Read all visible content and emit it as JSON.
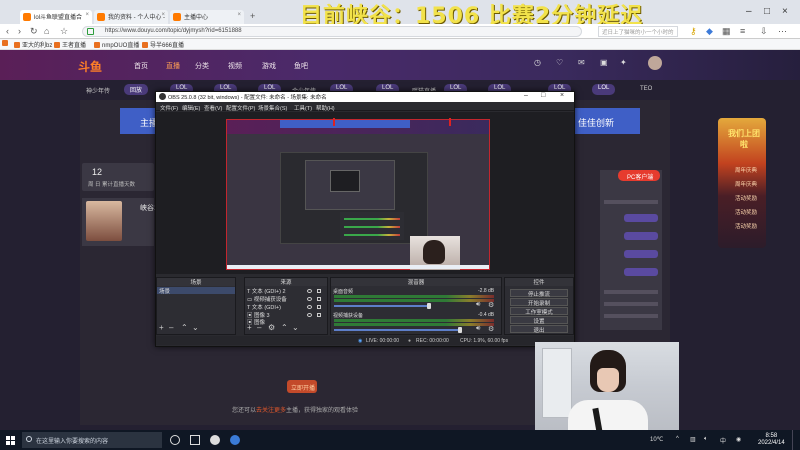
{
  "overlay_title": "目前峡谷：1506 比赛2分钟延迟",
  "browser": {
    "tabs": [
      {
        "label": "lol斗鱼联盟直播合"
      },
      {
        "label": "我的资料 - 个人中心 - "
      },
      {
        "label": "主播中心"
      }
    ],
    "url": "https://www.douyu.com/topic/dyjmysh?rid=6151888",
    "search_placeholder": "近日上了猫咪的小一个小时的",
    "bookmarks": [
      "亚大的利bz",
      "王者直播",
      "nmpOUO直播",
      "导半666直播"
    ]
  },
  "site": {
    "logo": "斗鱼",
    "nav": [
      "首页",
      "直播",
      "分类",
      "视频",
      "游戏",
      "鱼吧"
    ],
    "categories": [
      "回放",
      "LOL",
      "LOL",
      "LOL",
      "LOL",
      "LOL",
      "LOL",
      "LOL",
      "LOL",
      "LOL"
    ],
    "subtexts": [
      "神少年传",
      "金少年传",
      "胖猫直播",
      "TEO"
    ],
    "banner": [
      "主播",
      "佳佳创新"
    ],
    "stats_number": "12",
    "stats_label": "周 日 累计直播天数",
    "anchor_name": "峡谷1506",
    "pc_button": "PC客户端",
    "promo_title": "我们上团啦",
    "promo_items": [
      "周年庆典",
      "周年庆典",
      "活动奖励",
      "活动奖励",
      "活动奖励"
    ],
    "orange_button": "立即开播",
    "bottom_note_prefix": "您还可以",
    "bottom_note_link": "去关注更多",
    "bottom_note_suffix": "主播，获得独家的观看体验"
  },
  "obs": {
    "title": "OBS 25.0.8 (32 bit, windows) - 配置文件: 未命名 - 场景集: 未命名",
    "menu": [
      "文件(F)",
      "编辑(E)",
      "查看(V)",
      "配置文件(P)",
      "场景集合(S)",
      "工具(T)",
      "帮助(H)"
    ],
    "docks": {
      "scenes": "场景",
      "sources": "来源",
      "mixer": "混音器",
      "transitions": "转场特效",
      "controls": "控件"
    },
    "scene_items": [
      "场景"
    ],
    "source_items": [
      {
        "name": "文本 (GDI+) 2",
        "type": "T"
      },
      {
        "name": "视频捕获设备",
        "type": "cam"
      },
      {
        "name": "文本 (GDI+)",
        "type": "T"
      },
      {
        "name": "图像 3",
        "type": "img"
      },
      {
        "name": "图像",
        "type": "img"
      }
    ],
    "mixer_items": [
      {
        "name": "桌面音频",
        "db": "-2.8 dB",
        "level": 0.68
      },
      {
        "name": "视频捕获设备",
        "db": "-0.4 dB",
        "level": 0.9
      }
    ],
    "controls": [
      "停止推流",
      "开始录制",
      "工作室模式",
      "设置",
      "退出"
    ],
    "status": {
      "live": "LIVE: 00:00:00",
      "rec": "REC: 00:00:00",
      "cpu": "CPU: 1.9%, 60.00 fps"
    }
  },
  "taskbar": {
    "search_placeholder": "在这里输入你要搜索的内容",
    "time": "8:58",
    "date": "2022/4/14",
    "tray": [
      "10℃",
      "中"
    ]
  }
}
